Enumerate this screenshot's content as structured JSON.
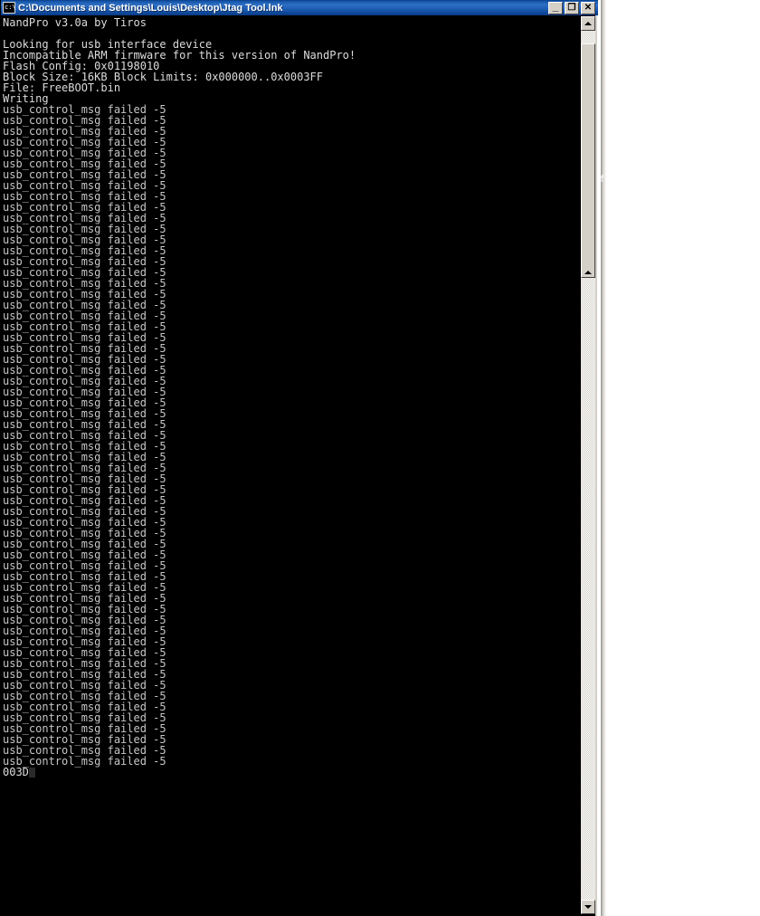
{
  "window": {
    "title": "C:\\Documents and Settings\\Louis\\Desktop\\Jtag Tool.lnk",
    "icon": "console-cmd-icon",
    "minimize_label": "_",
    "restore_label": "❐",
    "close_label": "✕",
    "titlebar_color": "#1555a8",
    "background_color": "#000000",
    "text_color": "#c6c6c6"
  },
  "console": {
    "header_lines": [
      "NandPro v3.0a by Tiros",
      "",
      "Looking for usb interface device",
      "Incompatible ARM firmware for this version of NandPro!",
      "Flash Config: 0x01198010",
      "Block Size: 16KB Block Limits: 0x000000..0x0003FF",
      "File: FreeBOOT.bin",
      "Writing"
    ],
    "error_line": "usb_control_msg failed -5",
    "error_line_count": 61,
    "final_line": "003D",
    "cursor_visible": true
  },
  "scrollbar": {
    "up_arrow": "▲",
    "down_arrow": "▼",
    "thumb_position_percent": 2,
    "thumb_size_percent": 27
  },
  "background": {
    "partial_glyph": "f"
  }
}
